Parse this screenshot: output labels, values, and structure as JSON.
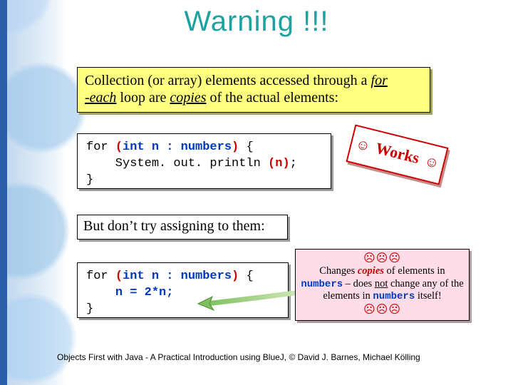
{
  "title": "Warning !!!",
  "warn": {
    "pre": "Collection (or array) elements accessed through a ",
    "for": "for",
    "dash": " -",
    "each": "each",
    "mid": " loop are ",
    "copies": "copies",
    "post": " of the actual elements:"
  },
  "code1": {
    "l1a": "for ",
    "l1b": "(",
    "l1c": "int n : numbers",
    "l1d": ")",
    "l1e": " {",
    "l2a": "    System. out. println ",
    "l2b": "(n)",
    "l2c": ";",
    "l3": "}"
  },
  "works": {
    "face": "☺",
    "label": " Works ",
    "face2": "☺"
  },
  "but": "But don’t try assigning to them:",
  "code2": {
    "l1a": "for ",
    "l1b": "(",
    "l1c": "int n : numbers",
    "l1d": ")",
    "l1e": " {",
    "l2a": "    ",
    "l2b": "n = 2*n;",
    "l3": "}"
  },
  "note": {
    "sad_row": "☹☹☹",
    "t1": "Changes ",
    "copies": "copies",
    "t2": " of elements in ",
    "numbers": "numbers",
    "t3": " – does ",
    "not": "not",
    "t4": " change any of the elements in ",
    "numbers2": "numbers",
    "t5": " itself!"
  },
  "footer": "Objects First with Java - A Practical Introduction using BlueJ, © David J. Barnes, Michael Kölling"
}
